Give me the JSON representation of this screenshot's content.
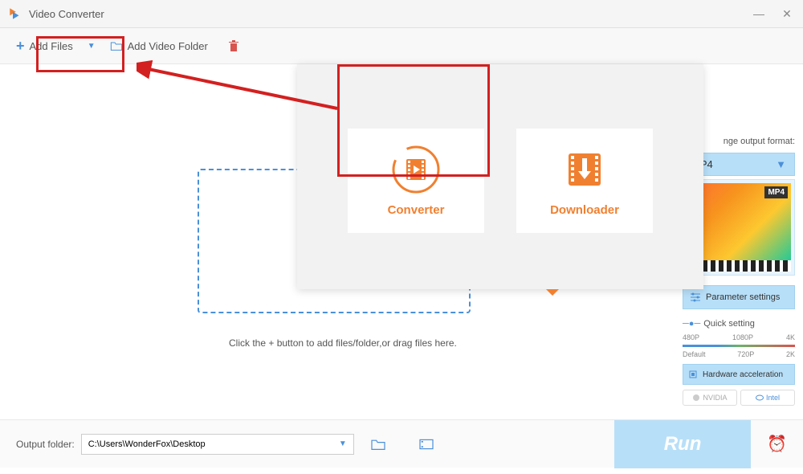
{
  "titlebar": {
    "title": "Video Converter"
  },
  "toolbar": {
    "add_files": "Add Files",
    "add_folder": "Add Video Folder"
  },
  "dropzone": {
    "hint": "Click the + button to add files/folder,or drag files here."
  },
  "overlay": {
    "converter": "Converter",
    "downloader": "Downloader"
  },
  "sidebar": {
    "format_label": "nge output format:",
    "format_value": "MP4",
    "preview_badge": "MP4",
    "param_settings": "Parameter settings",
    "quick_setting": "Quick setting",
    "resolutions_top": [
      "480P",
      "1080P",
      "4K"
    ],
    "resolutions_bottom": [
      "Default",
      "720P",
      "2K"
    ],
    "hw_accel": "Hardware acceleration",
    "gpu_nvidia": "NVIDIA",
    "gpu_intel": "Intel"
  },
  "bottom": {
    "output_label": "Output folder:",
    "output_path": "C:\\Users\\WonderFox\\Desktop",
    "run": "Run"
  }
}
